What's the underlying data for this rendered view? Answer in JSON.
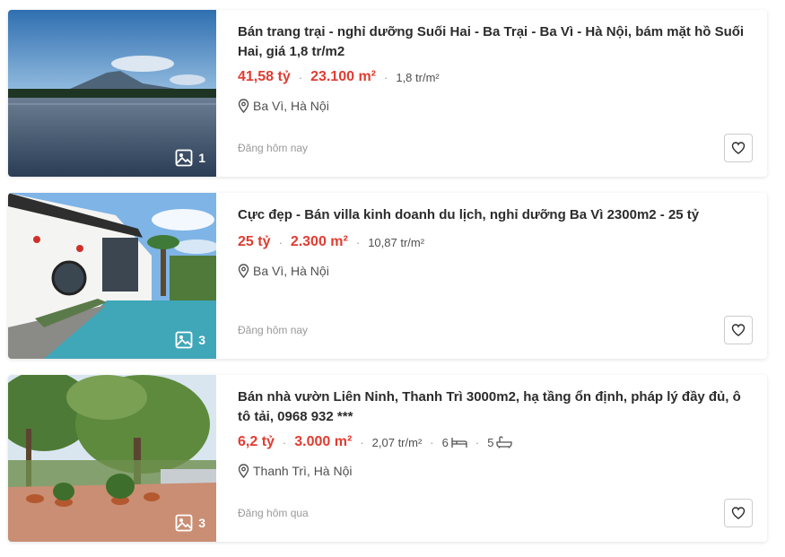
{
  "listings": [
    {
      "title": "Bán trang trại - nghỉ dưỡng Suối Hai - Ba Trại - Ba Vì - Hà Nội, bám mặt hồ Suối Hai, giá 1,8 tr/m2",
      "price": "41,58 tỷ",
      "area": "23.100 m²",
      "price_per_m2": "1,8 tr/m²",
      "location": "Ba Vì, Hà Nội",
      "posted": "Đăng hôm nay",
      "photo_count": "1",
      "icons": {
        "photo": "image-icon",
        "location": "map-pin-icon",
        "favorite": "heart-icon"
      }
    },
    {
      "title": "Cực đẹp - Bán villa kinh doanh du lịch, nghỉ dưỡng Ba Vì 2300m2 - 25 tỷ",
      "price": "25 tỷ",
      "area": "2.300 m²",
      "price_per_m2": "10,87 tr/m²",
      "location": "Ba Vì, Hà Nội",
      "posted": "Đăng hôm nay",
      "photo_count": "3",
      "icons": {
        "photo": "image-icon",
        "location": "map-pin-icon",
        "favorite": "heart-icon"
      }
    },
    {
      "title": "Bán nhà vườn Liên Ninh, Thanh Trì 3000m2, hạ tầng ổn định, pháp lý đầy đủ, ô tô tải, 0968 932 ***",
      "price": "6,2 tỷ",
      "area": "3.000 m²",
      "price_per_m2": "2,07 tr/m²",
      "bedrooms": "6",
      "bathrooms": "5",
      "location": "Thanh Trì, Hà Nội",
      "posted": "Đăng hôm qua",
      "photo_count": "3",
      "icons": {
        "photo": "image-icon",
        "location": "map-pin-icon",
        "favorite": "heart-icon",
        "bed": "bed-icon",
        "bath": "bathtub-icon"
      }
    }
  ],
  "colors": {
    "price": "#e03c31",
    "text": "#2c2c2c",
    "muted": "#999999"
  }
}
